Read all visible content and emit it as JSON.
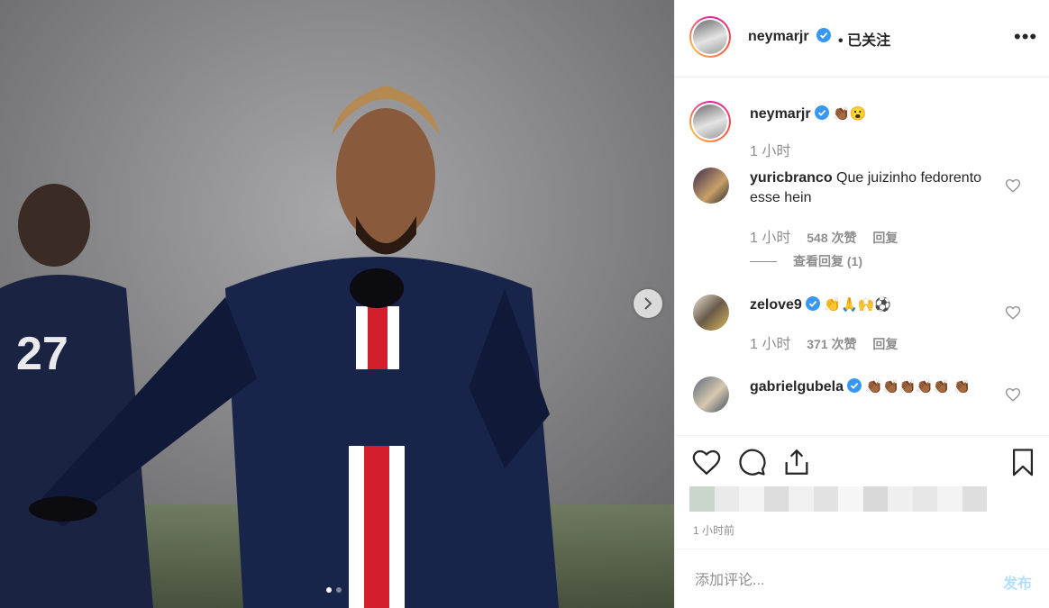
{
  "post": {
    "carousel_dots": 2,
    "active_dot": 0
  },
  "header": {
    "username": "neymarjr",
    "separator": "•",
    "follow_status": "已关注",
    "more_icon": "more-options-icon"
  },
  "caption": {
    "username": "neymarjr",
    "emojis": "👏🏾😮",
    "time": "1 小时"
  },
  "comments": [
    {
      "username": "yuricbranco",
      "text": "Que juizinho fedorento esse hein",
      "time": "1 小时",
      "likes": "548 次赞",
      "reply": "回复",
      "view_replies": "查看回复 (1)"
    },
    {
      "username": "zelove9",
      "verified": true,
      "text": "👏🙏🙌⚽",
      "time": "1 小时",
      "likes": "371 次赞",
      "reply": "回复"
    },
    {
      "username": "gabrielgubela",
      "verified": true,
      "text": "👏🏾👏🏾👏🏾👏🏾👏🏾 👏🏾"
    }
  ],
  "footer": {
    "time_ago": "1 小时前",
    "comment_placeholder": "添加评论...",
    "post_button": "发布"
  },
  "colors": {
    "verified": "#3897f0",
    "muted": "#8e8e8e",
    "post_disabled": "#b2dffc"
  }
}
